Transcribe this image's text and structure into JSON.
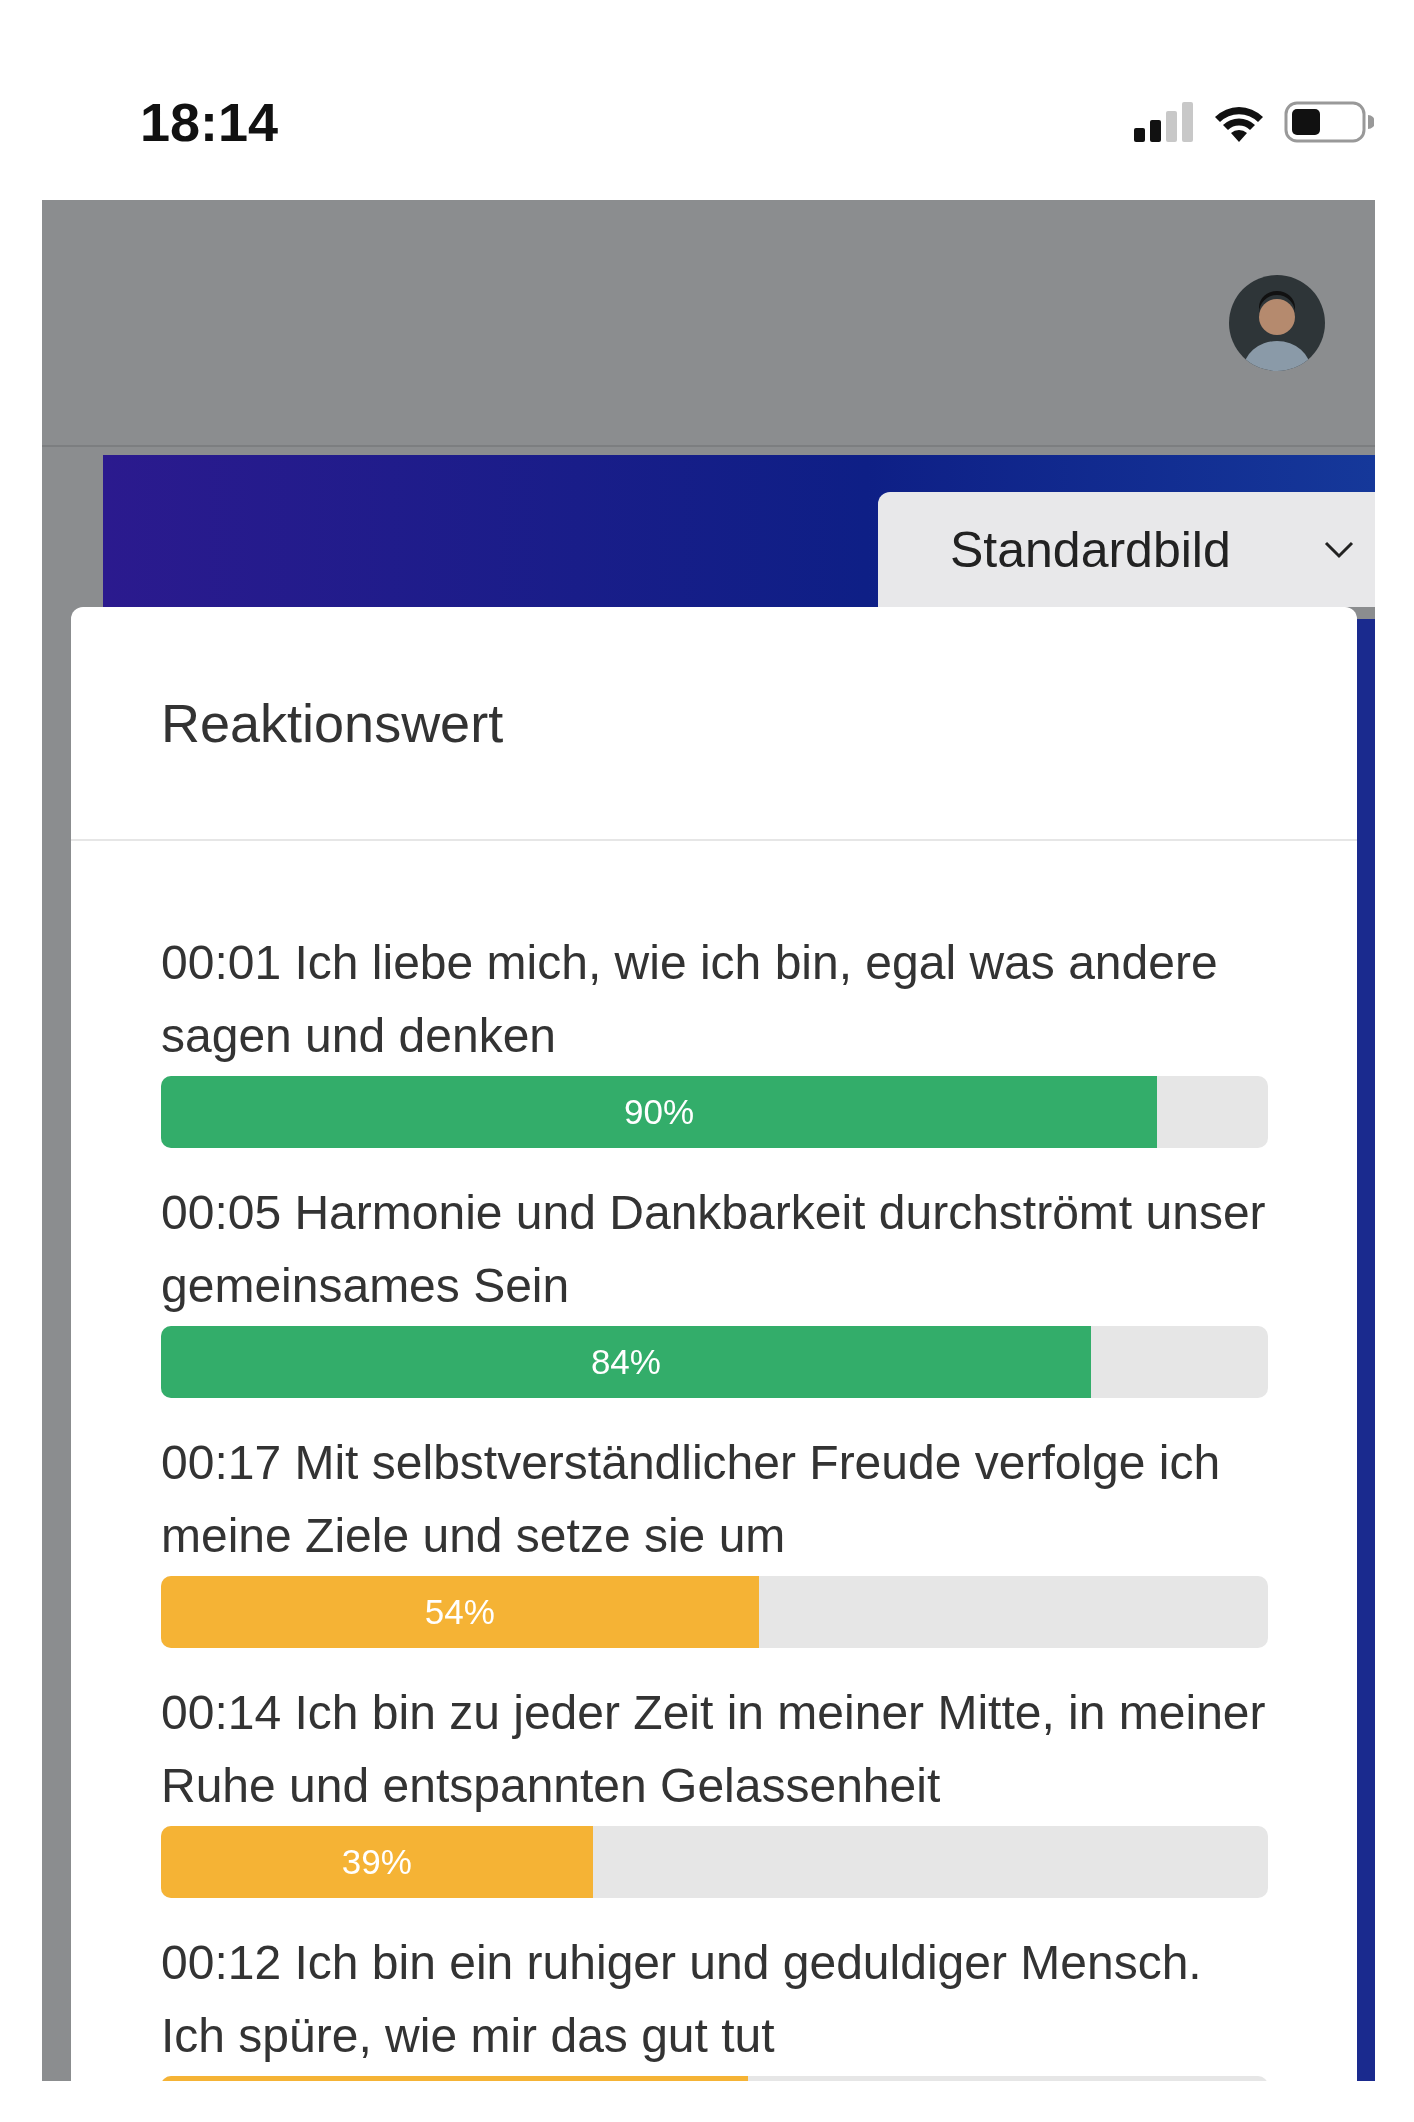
{
  "status_bar": {
    "time": "18:14"
  },
  "dropdown": {
    "value": "Standardbild"
  },
  "card": {
    "title": "Reaktionswert",
    "items": [
      {
        "text": "00:01 Ich liebe mich, wie ich bin, egal was andere sagen und denken",
        "level": 0.9,
        "label": "90%",
        "color": "#33ad6a"
      },
      {
        "text": "00:05 Harmonie und Dankbarkeit durchströmt unser gemeinsames Sein",
        "level": 0.84,
        "label": "84%",
        "color": "#33ad6a"
      },
      {
        "text": "00:17 Mit selbstverständlicher Freude verfolge ich meine Ziele und setze sie um",
        "level": 0.54,
        "label": "54%",
        "color": "#f5b335"
      },
      {
        "text": "00:14 Ich bin zu jeder Zeit in meiner Mitte, in meiner Ruhe und entspannten Gelassenheit",
        "level": 0.39,
        "label": "39%",
        "color": "#f5b335"
      },
      {
        "text": "00:12 Ich bin ein ruhiger und geduldiger Mensch. Ich spüre, wie mir das gut tut",
        "level": 0.53,
        "color": "#f5b335"
      }
    ]
  }
}
